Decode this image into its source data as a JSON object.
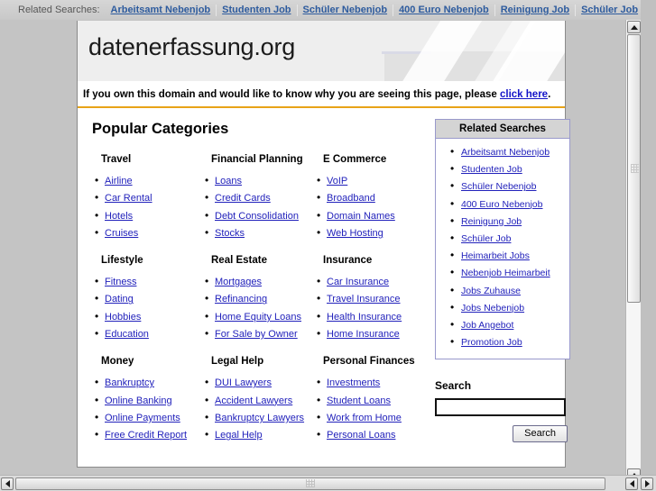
{
  "top_strip": {
    "label": "Related Searches:",
    "links": [
      "Arbeitsamt Nebenjob",
      "Studenten Job",
      "Schüler Nebenjob",
      "400 Euro Nebenjob",
      "Reinigung Job",
      "Schüler Job"
    ]
  },
  "header": {
    "domain": "datenerfassung.org"
  },
  "owner_note": {
    "text_before": "If you own this domain and would like to know why you are seeing this page, please ",
    "link": "click here",
    "text_after": "."
  },
  "main": {
    "heading": "Popular Categories",
    "rows": [
      [
        {
          "title": "Travel",
          "items": [
            "Airline",
            "Car Rental",
            "Hotels",
            "Cruises"
          ]
        },
        {
          "title": "Financial Planning",
          "items": [
            "Loans",
            "Credit Cards",
            "Debt Consolidation",
            "Stocks"
          ]
        },
        {
          "title": "E Commerce",
          "items": [
            "VoIP",
            "Broadband",
            "Domain Names",
            "Web Hosting"
          ]
        }
      ],
      [
        {
          "title": "Lifestyle",
          "items": [
            "Fitness",
            "Dating",
            "Hobbies",
            "Education"
          ]
        },
        {
          "title": "Real Estate",
          "items": [
            "Mortgages",
            "Refinancing",
            "Home Equity Loans",
            "For Sale by Owner"
          ]
        },
        {
          "title": "Insurance",
          "items": [
            "Car Insurance",
            "Travel Insurance",
            "Health Insurance",
            "Home Insurance"
          ]
        }
      ],
      [
        {
          "title": "Money",
          "items": [
            "Bankruptcy",
            "Online Banking",
            "Online Payments",
            "Free Credit Report"
          ]
        },
        {
          "title": "Legal Help",
          "items": [
            "DUI Lawyers",
            "Accident Lawyers",
            "Bankruptcy Lawyers",
            "Legal Help"
          ]
        },
        {
          "title": "Personal Finances",
          "items": [
            "Investments",
            "Student Loans",
            "Work from Home",
            "Personal Loans"
          ]
        }
      ]
    ]
  },
  "sidebar": {
    "box_title": "Related Searches",
    "items": [
      "Arbeitsamt Nebenjob",
      "Studenten Job",
      "Schüler Nebenjob",
      "400 Euro Nebenjob",
      "Reinigung Job",
      "Schüler Job",
      "Heimarbeit Jobs",
      "Nebenjob Heimarbeit",
      "Jobs Zuhause",
      "Jobs Nebenjob",
      "Job Angebot",
      "Promotion Job"
    ]
  },
  "search": {
    "label": "Search",
    "value": "",
    "placeholder": "",
    "button_label": "Search"
  },
  "colors": {
    "link": "#2222bb",
    "top_link": "#2d5b9e",
    "accent_rule": "#e8a317",
    "owner_link": "#1414c8",
    "box_border": "#9999cc",
    "page_bg": "#c4c4c4"
  }
}
